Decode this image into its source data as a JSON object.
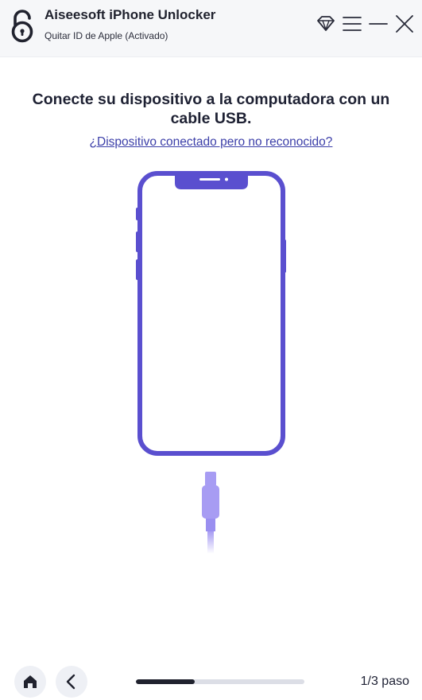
{
  "app": {
    "title": "Aiseesoft iPhone Unlocker",
    "mode": "Quitar ID de Apple (Activado)"
  },
  "window_controls": {
    "icons": [
      "diamond-icon",
      "hamburger-menu-icon",
      "minimize-icon",
      "close-icon"
    ]
  },
  "main": {
    "instruction": "Conecte su dispositivo a la computadora con un cable USB.",
    "help_link": "¿Dispositivo conectado pero no reconocido?",
    "illustration_icons": [
      "phone-outline-icon",
      "usb-cable-icon"
    ]
  },
  "footer": {
    "icons": [
      "home-icon",
      "chevron-left-icon"
    ],
    "progress_fraction": 0.35,
    "step_label": "1/3 paso"
  },
  "colors": {
    "accent": "#5a4fcf",
    "cable": "#a79cf3",
    "title_bar": "#f6f7f9",
    "link": "#3b3ea8"
  }
}
